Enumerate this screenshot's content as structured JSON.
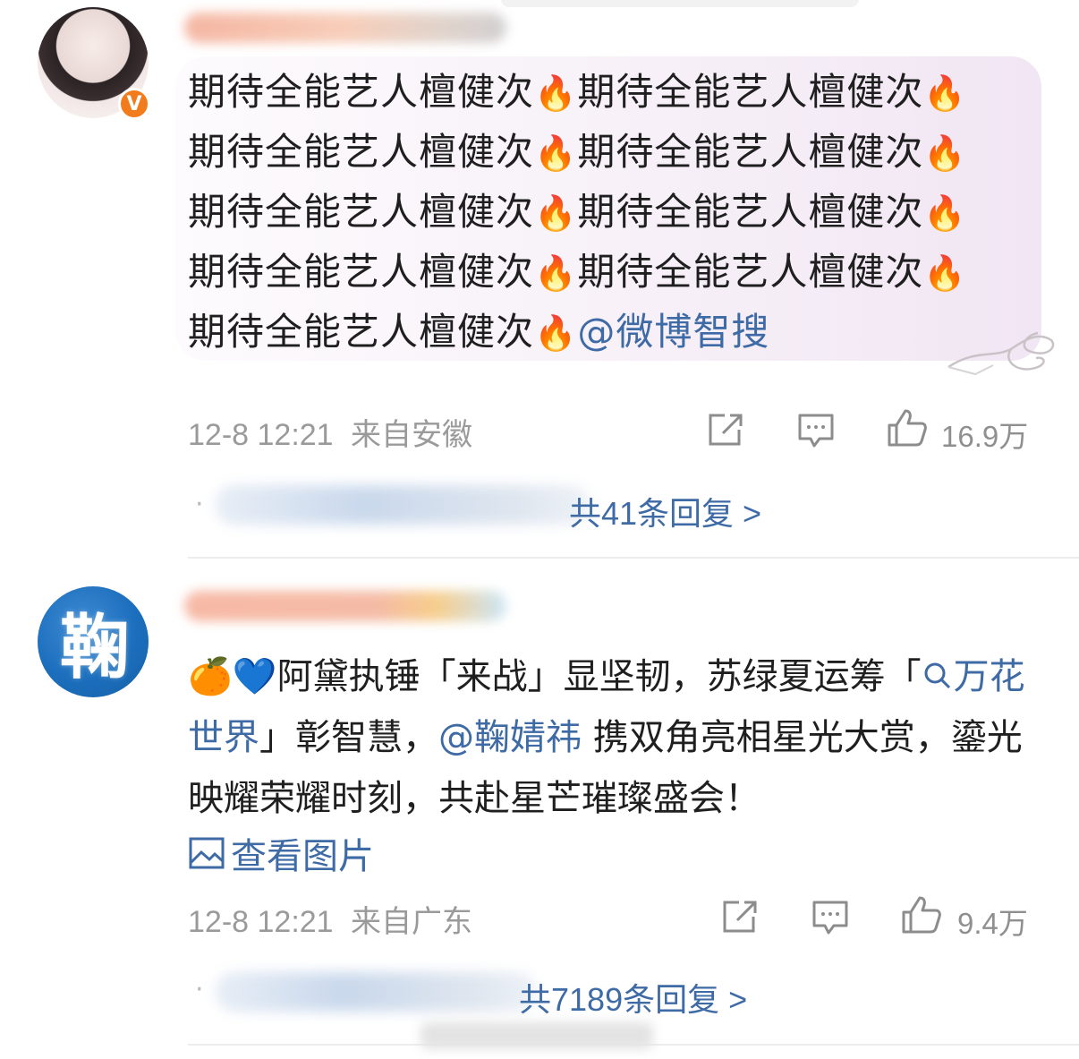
{
  "comments": [
    {
      "text_prefix_segments": [
        "期待全能艺人檀健次",
        "期待全能艺人檀健次",
        "期待全能艺人檀健次",
        "期待全能艺人檀健次",
        "期待全能艺人檀健次",
        "期待全能艺人檀健次",
        "期待全能艺人檀健次",
        "期待全能艺人檀健次",
        "期待全能艺人檀健次"
      ],
      "fire_emoji": "🔥",
      "mention": "@微博智搜",
      "timestamp": "12-8 12:21",
      "location": "来自安徽",
      "like_count": "16.9万",
      "reply_summary": "共41条回复 >"
    },
    {
      "emoji_prefix": "🍊💙",
      "line1": "阿黛执锤「来战」显坚韧，苏绿夏运筹「",
      "search_topic": "万花世界",
      "line2_after_topic": "」彰智慧，",
      "mention": "@鞠婧祎",
      "line2_rest": " 携双角亮相星光大赏，鎏光映耀荣耀时刻，共赴星芒璀璨盛会！",
      "view_pics": "查看图片",
      "timestamp": "12-8 12:21",
      "location": "来自广东",
      "like_count": "9.4万",
      "reply_summary": "共7189条回复 >"
    }
  ],
  "verified_badge": "V",
  "avatar2_glyph": "鞠",
  "icons": {
    "repost": "repost-icon",
    "comment": "comment-icon",
    "like": "thumbs-up-icon",
    "search": "search-icon",
    "image": "image-icon"
  },
  "colors": {
    "link": "#3e6aa5",
    "meta": "#9a9a9a",
    "badge": "#f27b1b"
  }
}
